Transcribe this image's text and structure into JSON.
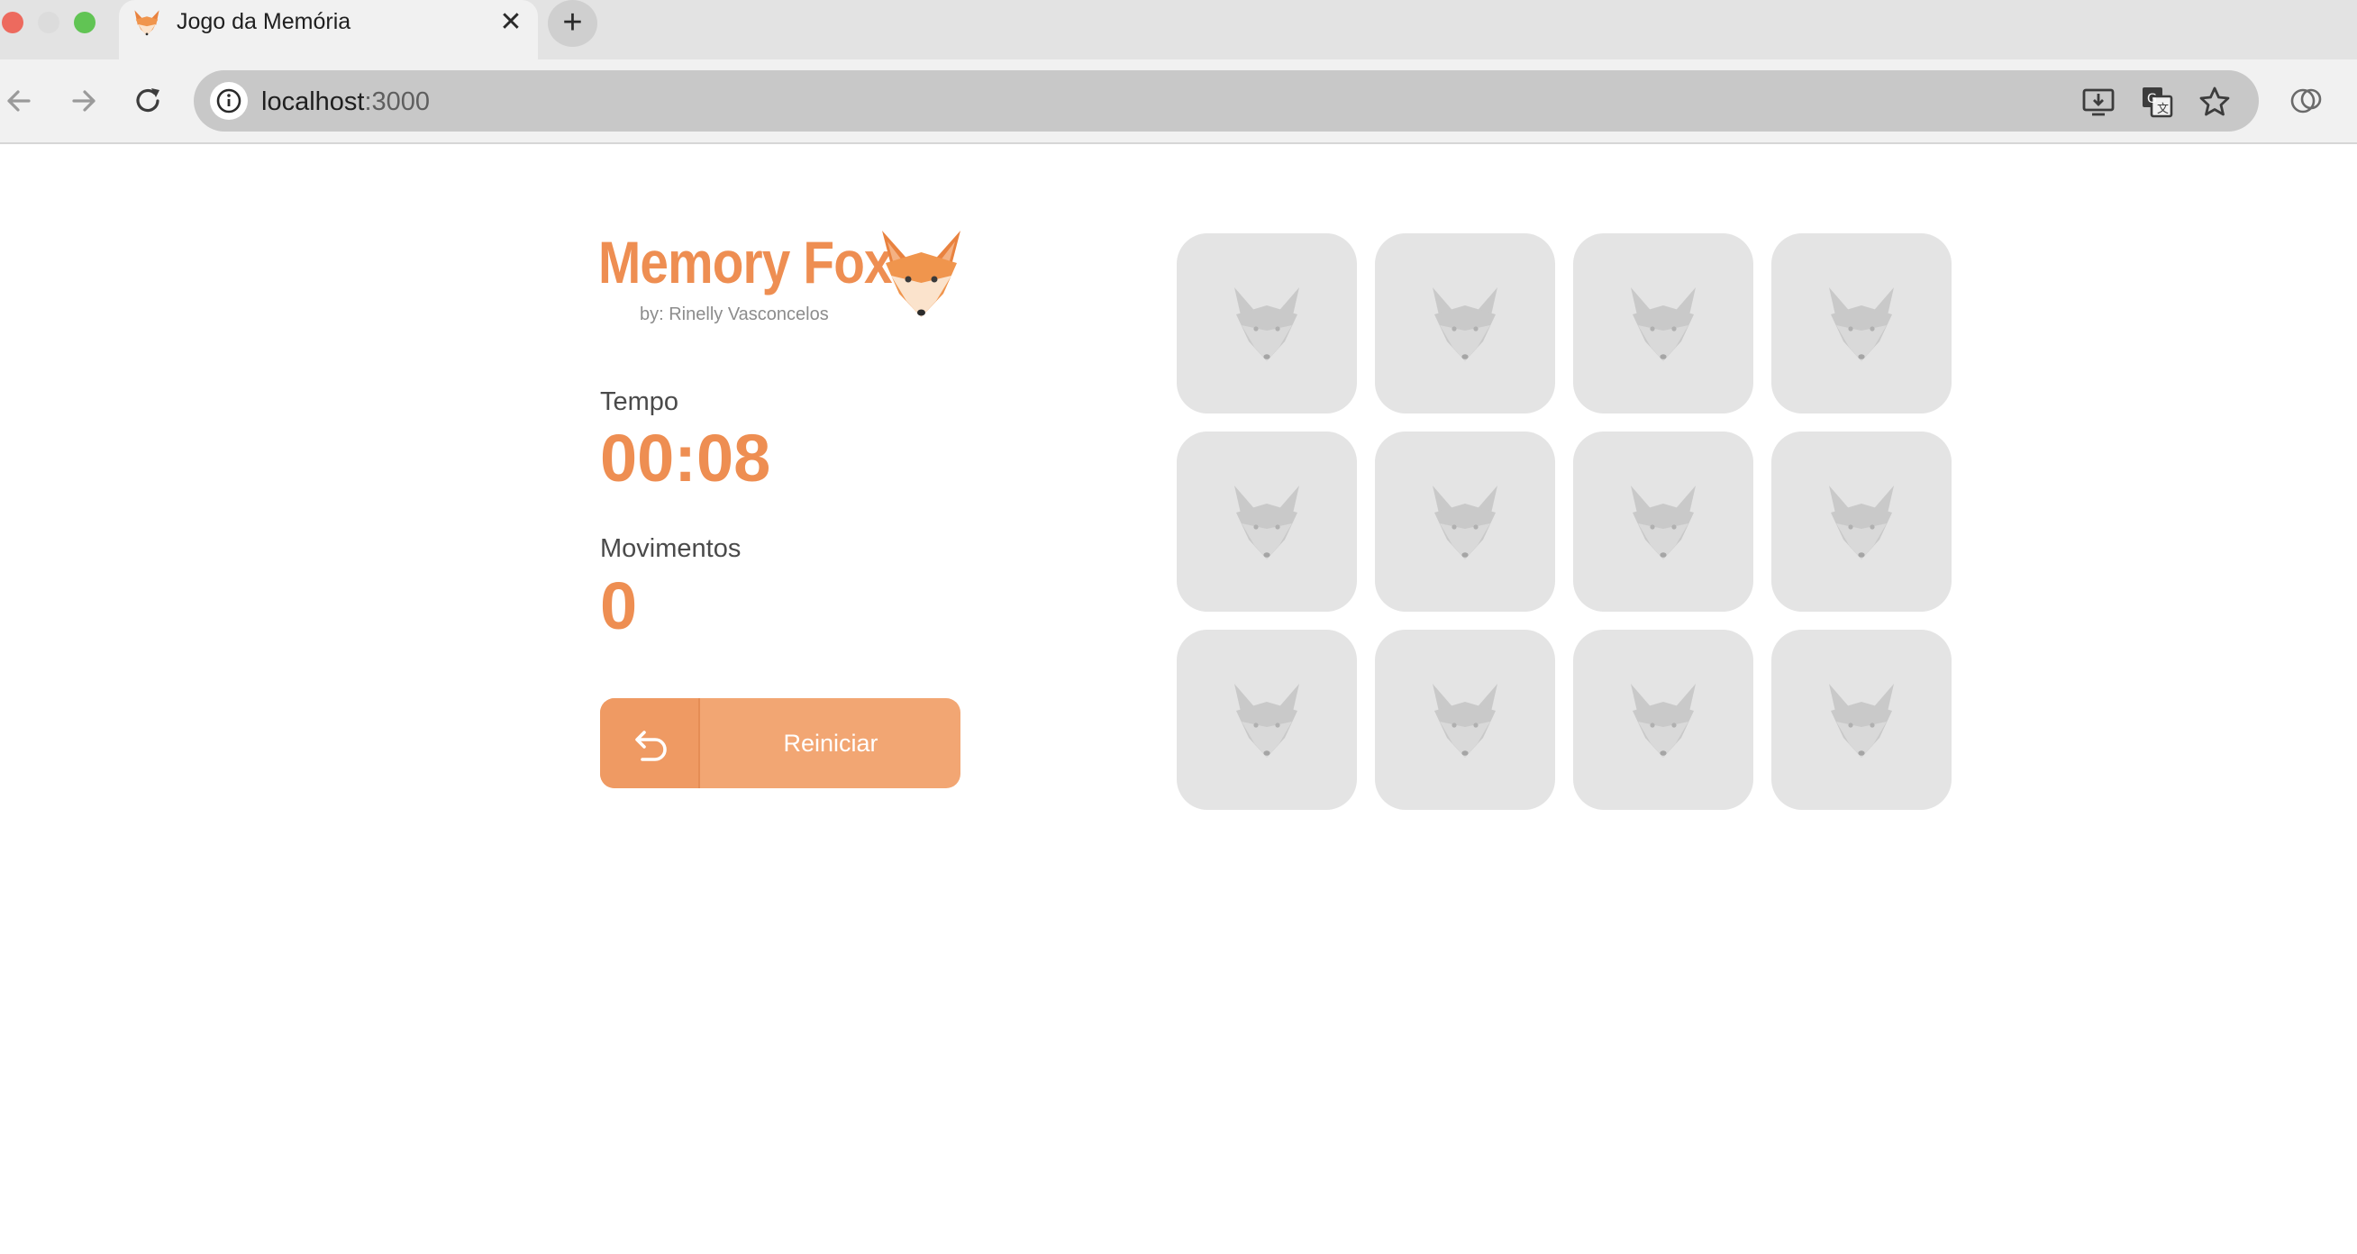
{
  "browser": {
    "tab_title": "Jogo da Memória",
    "tab_close_glyph": "✕",
    "new_tab_glyph": "+",
    "url_host": "localhost",
    "url_port": ":3000",
    "icons": [
      "back-arrow-icon",
      "forward-arrow-icon",
      "reload-icon",
      "site-info-icon",
      "install-app-icon",
      "translate-icon",
      "bookmark-star-icon",
      "profile-icon"
    ]
  },
  "logo": {
    "title": "Memory Fox",
    "byline": "by: Rinelly Vasconcelos",
    "icon": "fox-icon"
  },
  "stats": {
    "time_label": "Tempo",
    "time_value": "00:08",
    "moves_label": "Movimentos",
    "moves_value": "0"
  },
  "restart": {
    "label": "Reiniciar",
    "icon": "undo-arrow-icon"
  },
  "board": {
    "rows": 3,
    "columns": 4,
    "cards": [
      "face-down",
      "face-down",
      "face-down",
      "face-down",
      "face-down",
      "face-down",
      "face-down",
      "face-down",
      "face-down",
      "face-down",
      "face-down",
      "face-down"
    ],
    "card_back_icon": "fox-silhouette-icon"
  },
  "colors": {
    "accent": "#ee8e52",
    "button": "#f2a673",
    "card": "#e4e4e4",
    "card_icon": "#c9c9c9"
  }
}
